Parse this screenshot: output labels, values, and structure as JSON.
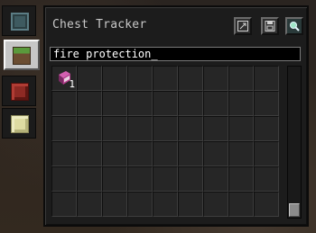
{
  "window": {
    "title": "Chest Tracker"
  },
  "tabs": [
    {
      "name": "glass-block-icon",
      "selected": false
    },
    {
      "name": "grass-block-icon",
      "selected": true
    },
    {
      "name": "redstone-block-icon",
      "selected": false
    },
    {
      "name": "end-stone-block-icon",
      "selected": false
    }
  ],
  "toolbar": {
    "buttons": [
      {
        "name": "resize-button",
        "icon": "resize-icon"
      },
      {
        "name": "save-button",
        "icon": "floppy-disk-icon"
      },
      {
        "name": "search-button",
        "icon": "magnifier-icon"
      }
    ]
  },
  "search": {
    "value": "fire protection_"
  },
  "grid": {
    "columns": 9,
    "rows": 6,
    "items": [
      {
        "slot": 0,
        "icon": "enchanted-book-icon",
        "count": "1"
      }
    ]
  },
  "colors": {
    "accent_book": "#b83f8f",
    "panel": "#1c1c1c"
  }
}
